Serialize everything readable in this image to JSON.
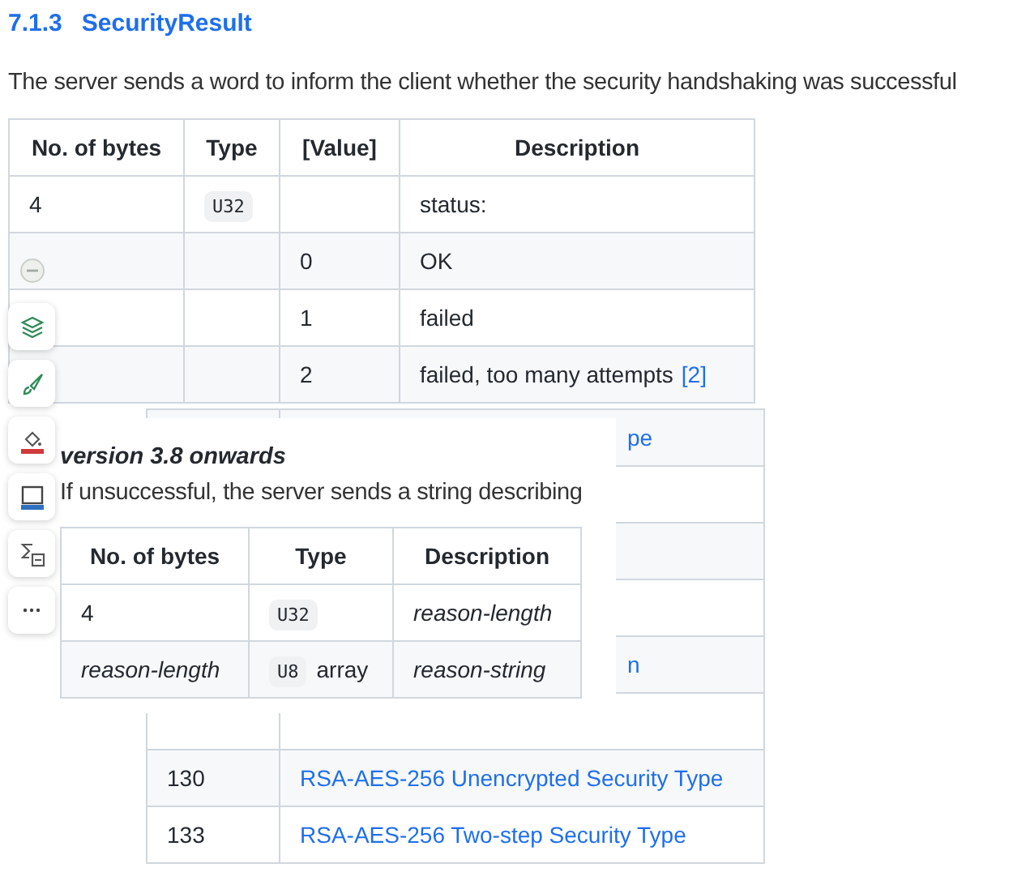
{
  "heading": {
    "number": "7.1.3",
    "title": "SecurityResult"
  },
  "intro": "The server sends a word to inform the client whether the security handshaking was successful",
  "table": {
    "columns": [
      "No. of bytes",
      "Type",
      "[Value]",
      "Description"
    ],
    "rows": [
      {
        "cells": [
          {
            "kind": "text",
            "text": "4"
          },
          {
            "kind": "code",
            "text": "U32"
          },
          {
            "kind": "empty"
          },
          {
            "kind": "text",
            "text": "status:"
          }
        ]
      },
      {
        "cells": [
          {
            "kind": "empty"
          },
          {
            "kind": "empty"
          },
          {
            "kind": "text",
            "text": "0"
          },
          {
            "kind": "text",
            "text": "OK"
          }
        ]
      },
      {
        "cells": [
          {
            "kind": "empty"
          },
          {
            "kind": "empty"
          },
          {
            "kind": "text",
            "text": "1"
          },
          {
            "kind": "text",
            "text": "failed"
          }
        ]
      },
      {
        "cells": [
          {
            "kind": "empty"
          },
          {
            "kind": "empty"
          },
          {
            "kind": "text",
            "text": "2"
          },
          {
            "kind": "ref",
            "text": "failed, too many attempts",
            "ref": "[2]"
          }
        ]
      }
    ]
  },
  "background_table": {
    "rows": [
      {
        "column_1": "",
        "column_2": "pe",
        "kind": "fragment"
      },
      {
        "column_1": "",
        "column_2": "",
        "kind": "fragment"
      },
      {
        "column_1": "",
        "column_2": "",
        "kind": "fragment"
      },
      {
        "column_1": "",
        "column_2": "",
        "kind": "fragment"
      },
      {
        "column_1": "",
        "column_2": "n",
        "kind": "fragment"
      },
      {
        "column_1": "",
        "column_2": "",
        "kind": "link"
      },
      {
        "column_1": "130",
        "column_2": "RSA-AES-256 Unencrypted Security Type",
        "kind": "link"
      },
      {
        "column_1": "133",
        "column_2": "RSA-AES-256 Two-step Security Type",
        "kind": "link"
      }
    ]
  },
  "popup": {
    "title": "version 3.8 onwards",
    "text": "If unsuccessful, the server sends a string describing",
    "table": {
      "columns": [
        "No. of bytes",
        "Type",
        "Description"
      ],
      "rows": [
        {
          "cells": [
            {
              "kind": "text",
              "text": "4"
            },
            {
              "kind": "code",
              "text": "U32"
            },
            {
              "kind": "italic",
              "text": "reason-length"
            }
          ]
        },
        {
          "cells": [
            {
              "kind": "italic",
              "text": "reason-length"
            },
            {
              "kind": "code_suffix",
              "code": "U8",
              "text": "array"
            },
            {
              "kind": "italic",
              "text": "reason-string"
            }
          ]
        }
      ]
    }
  },
  "toolbar": {
    "tools": [
      {
        "kind": "collapse"
      },
      {
        "kind": "layers"
      },
      {
        "kind": "brush"
      },
      {
        "kind": "fill"
      },
      {
        "kind": "screen"
      },
      {
        "kind": "formula"
      },
      {
        "kind": "more"
      }
    ]
  }
}
